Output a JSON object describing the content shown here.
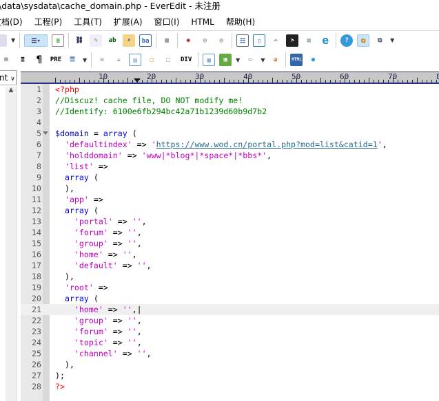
{
  "window": {
    "title": "\\data\\sysdata\\cache_domain.php - EverEdit - 未注册"
  },
  "menu": [
    "文档(D)",
    "工程(P)",
    "工具(T)",
    "扩展(A)",
    "窗口(I)",
    "HTML",
    "帮助(H)"
  ],
  "toolbar2": {
    "pre_label": "PRE",
    "div_label": "DIV",
    "html_label": "HTML"
  },
  "left_panel": {
    "combo_value": "nt"
  },
  "ruler": {
    "numbers": [
      "10",
      "20",
      "30",
      "40",
      "50",
      "60",
      "70",
      "8"
    ]
  },
  "editor": {
    "current_line": 21,
    "lines": [
      [
        [
          "tag",
          "<?php"
        ]
      ],
      [
        [
          "com",
          "//Discuz! cache file, DO NOT modify me!"
        ]
      ],
      [
        [
          "com",
          "//Identify: 6100e6fb294bc42a71b1239d60b9d7b2"
        ]
      ],
      [],
      [
        [
          "var",
          "$domain"
        ],
        [
          "op",
          " = "
        ],
        [
          "kw",
          "array"
        ],
        [
          "op",
          " ("
        ]
      ],
      [
        [
          "op",
          "  "
        ],
        [
          "str",
          "'defaultindex'"
        ],
        [
          "op",
          " => "
        ],
        [
          "str",
          "'"
        ],
        [
          "url",
          "https://www.wod.cn/portal.php?mod=list&catid=1"
        ],
        [
          "str",
          "'"
        ],
        [
          "op",
          ","
        ]
      ],
      [
        [
          "op",
          "  "
        ],
        [
          "str",
          "'holddomain'"
        ],
        [
          "op",
          " => "
        ],
        [
          "str",
          "'www|*blog*|*space*|*bbs*'"
        ],
        [
          "op",
          ","
        ]
      ],
      [
        [
          "op",
          "  "
        ],
        [
          "str",
          "'list'"
        ],
        [
          "op",
          " =>"
        ]
      ],
      [
        [
          "op",
          "  "
        ],
        [
          "kw",
          "array"
        ],
        [
          "op",
          " ("
        ]
      ],
      [
        [
          "op",
          "  ),"
        ]
      ],
      [
        [
          "op",
          "  "
        ],
        [
          "str",
          "'app'"
        ],
        [
          "op",
          " =>"
        ]
      ],
      [
        [
          "op",
          "  "
        ],
        [
          "kw",
          "array"
        ],
        [
          "op",
          " ("
        ]
      ],
      [
        [
          "op",
          "    "
        ],
        [
          "str",
          "'portal'"
        ],
        [
          "op",
          " => "
        ],
        [
          "str",
          "''"
        ],
        [
          "op",
          ","
        ]
      ],
      [
        [
          "op",
          "    "
        ],
        [
          "str",
          "'forum'"
        ],
        [
          "op",
          " => "
        ],
        [
          "str",
          "''"
        ],
        [
          "op",
          ","
        ]
      ],
      [
        [
          "op",
          "    "
        ],
        [
          "str",
          "'group'"
        ],
        [
          "op",
          " => "
        ],
        [
          "str",
          "''"
        ],
        [
          "op",
          ","
        ]
      ],
      [
        [
          "op",
          "    "
        ],
        [
          "str",
          "'home'"
        ],
        [
          "op",
          " => "
        ],
        [
          "str",
          "''"
        ],
        [
          "op",
          ","
        ]
      ],
      [
        [
          "op",
          "    "
        ],
        [
          "str",
          "'default'"
        ],
        [
          "op",
          " => "
        ],
        [
          "str",
          "''"
        ],
        [
          "op",
          ","
        ]
      ],
      [
        [
          "op",
          "  ),"
        ]
      ],
      [
        [
          "op",
          "  "
        ],
        [
          "str",
          "'root'"
        ],
        [
          "op",
          " =>"
        ]
      ],
      [
        [
          "op",
          "  "
        ],
        [
          "kw",
          "array"
        ],
        [
          "op",
          " ("
        ]
      ],
      [
        [
          "op",
          "    "
        ],
        [
          "str",
          "'home'"
        ],
        [
          "op",
          " => "
        ],
        [
          "str",
          "''"
        ],
        [
          "op",
          ",|"
        ]
      ],
      [
        [
          "op",
          "    "
        ],
        [
          "str",
          "'group'"
        ],
        [
          "op",
          " => "
        ],
        [
          "str",
          "''"
        ],
        [
          "op",
          ","
        ]
      ],
      [
        [
          "op",
          "    "
        ],
        [
          "str",
          "'forum'"
        ],
        [
          "op",
          " => "
        ],
        [
          "str",
          "''"
        ],
        [
          "op",
          ","
        ]
      ],
      [
        [
          "op",
          "    "
        ],
        [
          "str",
          "'topic'"
        ],
        [
          "op",
          " => "
        ],
        [
          "str",
          "''"
        ],
        [
          "op",
          ","
        ]
      ],
      [
        [
          "op",
          "    "
        ],
        [
          "str",
          "'channel'"
        ],
        [
          "op",
          " => "
        ],
        [
          "str",
          "''"
        ],
        [
          "op",
          ","
        ]
      ],
      [
        [
          "op",
          "  ),"
        ]
      ],
      [
        [
          "op",
          ");"
        ]
      ],
      [
        [
          "tag",
          "?>"
        ]
      ]
    ]
  }
}
